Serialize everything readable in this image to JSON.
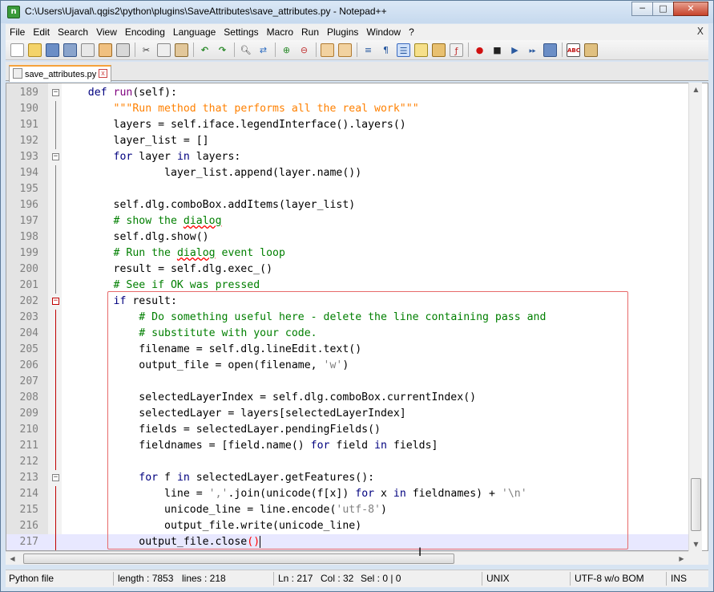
{
  "window": {
    "title": "C:\\Users\\Ujaval\\.qgis2\\python\\plugins\\SaveAttributes\\save_attributes.py - Notepad++",
    "minimize": "─",
    "maximize": "□",
    "close": "✕"
  },
  "menu": {
    "items": [
      "File",
      "Edit",
      "Search",
      "View",
      "Encoding",
      "Language",
      "Settings",
      "Macro",
      "Run",
      "Plugins",
      "Window",
      "?"
    ],
    "close": "X"
  },
  "toolbar": {
    "icons": [
      "new-file-icon",
      "open-file-icon",
      "save-icon",
      "save-all-icon",
      "close-icon",
      "close-all-icon",
      "print-icon",
      "cut-icon",
      "copy-icon",
      "paste-icon",
      "undo-icon",
      "redo-icon",
      "find-icon",
      "replace-icon",
      "zoom-in-icon",
      "zoom-out-icon",
      "sync-vertical-icon",
      "sync-horizontal-icon",
      "word-wrap-icon",
      "show-all-chars-icon",
      "indent-guide-icon",
      "user-language-icon",
      "doc-map-icon",
      "function-list-icon",
      "record-macro-icon",
      "stop-macro-icon",
      "play-macro-icon",
      "run-macro-multiple-icon",
      "save-macro-icon",
      "spell-check-icon",
      "extra-icon"
    ]
  },
  "tab": {
    "label": "save_attributes.py"
  },
  "editor": {
    "lines": [
      {
        "n": "189",
        "html": "    <span class='kw'>def</span> <span class='fn'>run</span>(self):"
      },
      {
        "n": "190",
        "html": "        <span class='doc'>\"\"\"Run method that performs all the real work\"\"\"</span>"
      },
      {
        "n": "191",
        "html": "        layers = self.iface.legendInterface().layers()"
      },
      {
        "n": "192",
        "html": "        layer_list = []"
      },
      {
        "n": "193",
        "html": "        <span class='kw'>for</span> layer <span class='kw'>in</span> layers:"
      },
      {
        "n": "194",
        "html": "                layer_list.append(layer.name())"
      },
      {
        "n": "195",
        "html": ""
      },
      {
        "n": "196",
        "html": "        self.dlg.comboBox.addItems(layer_list)"
      },
      {
        "n": "197",
        "html": "        <span class='cm'># show the <span class='sq'>dialog</span></span>"
      },
      {
        "n": "198",
        "html": "        self.dlg.show()"
      },
      {
        "n": "199",
        "html": "        <span class='cm'># Run the <span class='sq'>dialog</span> event loop</span>"
      },
      {
        "n": "200",
        "html": "        result = self.dlg.exec_()"
      },
      {
        "n": "201",
        "html": "        <span class='cm'># See if OK was pressed</span>"
      },
      {
        "n": "202",
        "html": "        <span class='kw'>if</span> result:"
      },
      {
        "n": "203",
        "html": "            <span class='cm'># Do something useful here - delete the line containing pass and</span>"
      },
      {
        "n": "204",
        "html": "            <span class='cm'># substitute with your code.</span>"
      },
      {
        "n": "205",
        "html": "            filename = self.dlg.lineEdit.text()"
      },
      {
        "n": "206",
        "html": "            output_file = open(filename, <span class='str'>'w'</span>)"
      },
      {
        "n": "207",
        "html": ""
      },
      {
        "n": "208",
        "html": "            selectedLayerIndex = self.dlg.comboBox.currentIndex()"
      },
      {
        "n": "209",
        "html": "            selectedLayer = layers[selectedLayerIndex]"
      },
      {
        "n": "210",
        "html": "            fields = selectedLayer.pendingFields()"
      },
      {
        "n": "211",
        "html": "            fieldnames = [field.name() <span class='kw'>for</span> field <span class='kw'>in</span> fields]"
      },
      {
        "n": "212",
        "html": ""
      },
      {
        "n": "213",
        "html": "            <span class='kw'>for</span> f <span class='kw'>in</span> selectedLayer.getFeatures():"
      },
      {
        "n": "214",
        "html": "                line = <span class='str'>','</span>.join(unicode(f[x]) <span class='kw'>for</span> x <span class='kw'>in</span> fieldnames) + <span class='str'>'\\n'</span>"
      },
      {
        "n": "215",
        "html": "                unicode_line = line.encode(<span class='str'>'utf-8'</span>)"
      },
      {
        "n": "216",
        "html": "                output_file.write(unicode_line)"
      },
      {
        "n": "217",
        "html": "            output_file.close<span class='bad'>()</span><span class='caret'></span>"
      }
    ],
    "folds": {
      "189": "minus",
      "193": "minus",
      "202": "minus-red",
      "213": "minus"
    }
  },
  "status": {
    "file_type": "Python file",
    "length": "length : 7853",
    "lines": "lines : 218",
    "ln": "Ln : 217",
    "col": "Col : 32",
    "sel": "Sel : 0 | 0",
    "eol": "UNIX",
    "encoding": "UTF-8 w/o BOM",
    "mode": "INS"
  }
}
